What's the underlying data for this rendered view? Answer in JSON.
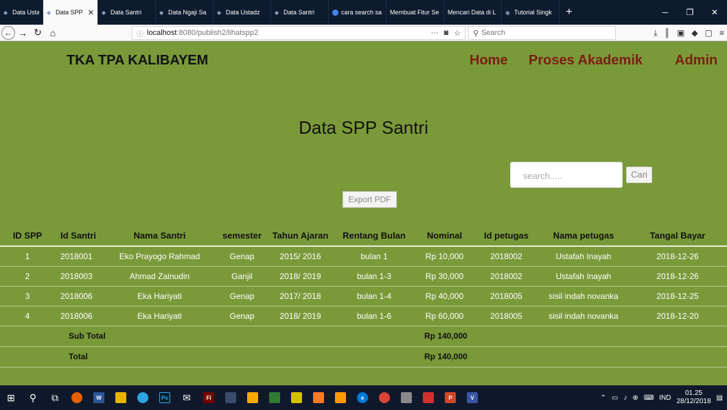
{
  "browser": {
    "tabs": [
      {
        "label": "Data Ustadz",
        "active": false
      },
      {
        "label": "Data SPP",
        "active": true
      },
      {
        "label": "Data Santri",
        "active": false
      },
      {
        "label": "Data Ngaji Sa",
        "active": false
      },
      {
        "label": "Data Ustadz",
        "active": false
      },
      {
        "label": "Data Santri",
        "active": false
      },
      {
        "label": "cara search sa",
        "active": false
      },
      {
        "label": "Membuat Fitur Se",
        "active": false
      },
      {
        "label": "Mencari Data di L",
        "active": false
      },
      {
        "label": "Tutorial Singk",
        "active": false
      }
    ],
    "url_host": "localhost",
    "url_path": ":8080/publish2/lihatspp2",
    "search_placeholder": "Search"
  },
  "site": {
    "brand": "TKA TPA KALIBAYEM",
    "menu": {
      "home": "Home",
      "akademik": "Proses Akademik",
      "admin": "Admin"
    }
  },
  "main": {
    "title": "Data SPP Santri",
    "search_placeholder": "search.....",
    "search_button": "Cari",
    "export_button": "Export PDF"
  },
  "table": {
    "headers": [
      "ID SPP",
      "Id Santri",
      "Nama Santri",
      "semester",
      "Tahun Ajaran",
      "Rentang Bulan",
      "Nominal",
      "Id petugas",
      "Nama petugas",
      "Tangal Bayar"
    ],
    "rows": [
      [
        "1",
        "2018001",
        "Eko Prayogo Rahmad",
        "Genap",
        "2015/ 2016",
        "bulan 1",
        "Rp 10,000",
        "2018002",
        "Ustafah Inayah",
        "2018-12-26"
      ],
      [
        "2",
        "2018003",
        "Ahmad Zainudin",
        "Ganjil",
        "2018/ 2019",
        "bulan 1-3",
        "Rp 30,000",
        "2018002",
        "Ustafah Inayah",
        "2018-12-26"
      ],
      [
        "3",
        "2018006",
        "Eka Hariyati",
        "Genap",
        "2017/ 2018",
        "bulan 1-4",
        "Rp 40,000",
        "2018005",
        "sisil indah novanka",
        "2018-12-25"
      ],
      [
        "4",
        "2018006",
        "Eka Hariyati",
        "Genap",
        "2018/ 2019",
        "bulan 1-6",
        "Rp 60,000",
        "2018005",
        "sisil indah novanka",
        "2018-12-20"
      ]
    ],
    "subtotal_label": "Sub Total",
    "subtotal_value": "Rp 140,000",
    "total_label": "Total",
    "total_value": "Rp 140,000"
  },
  "taskbar": {
    "language": "IND",
    "time": "01.25",
    "date": "28/12/2018"
  },
  "colors": {
    "page_bg": "#7a9a3a",
    "menu_text": "#7a1f12",
    "tab_strip": "#0d1b2f",
    "taskbar": "#10192c"
  }
}
